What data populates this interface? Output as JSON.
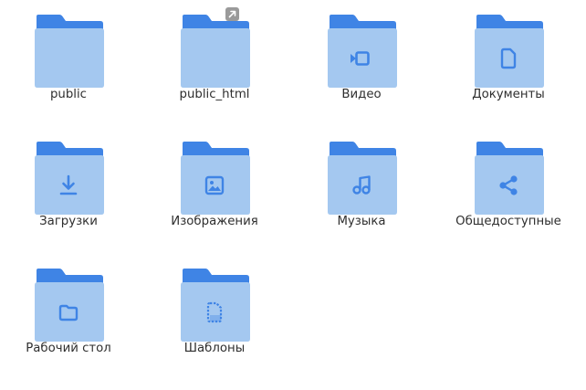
{
  "colors": {
    "folder_tab": "#3f84e5",
    "folder_front": "#a4c8f0",
    "emblem": "#3f84e5",
    "label": "#2e2e2e",
    "link_badge": "#9a9a9a"
  },
  "folders": [
    {
      "label": "public",
      "icon": "folder-icon",
      "emblem": "none"
    },
    {
      "label": "public_html",
      "icon": "folder-icon",
      "emblem": "none",
      "symlink": true
    },
    {
      "label": "Видео",
      "icon": "folder-videos-icon",
      "emblem": "video"
    },
    {
      "label": "Документы",
      "icon": "folder-documents-icon",
      "emblem": "document"
    },
    {
      "label": "Загрузки",
      "icon": "folder-downloads-icon",
      "emblem": "download"
    },
    {
      "label": "Изображения",
      "icon": "folder-pictures-icon",
      "emblem": "picture"
    },
    {
      "label": "Музыка",
      "icon": "folder-music-icon",
      "emblem": "music"
    },
    {
      "label": "Общедоступные",
      "icon": "folder-publicshare-icon",
      "emblem": "share"
    },
    {
      "label": "Рабочий стол",
      "icon": "folder-desktop-icon",
      "emblem": "desktop"
    },
    {
      "label": "Шаблоны",
      "icon": "folder-templates-icon",
      "emblem": "template"
    }
  ]
}
